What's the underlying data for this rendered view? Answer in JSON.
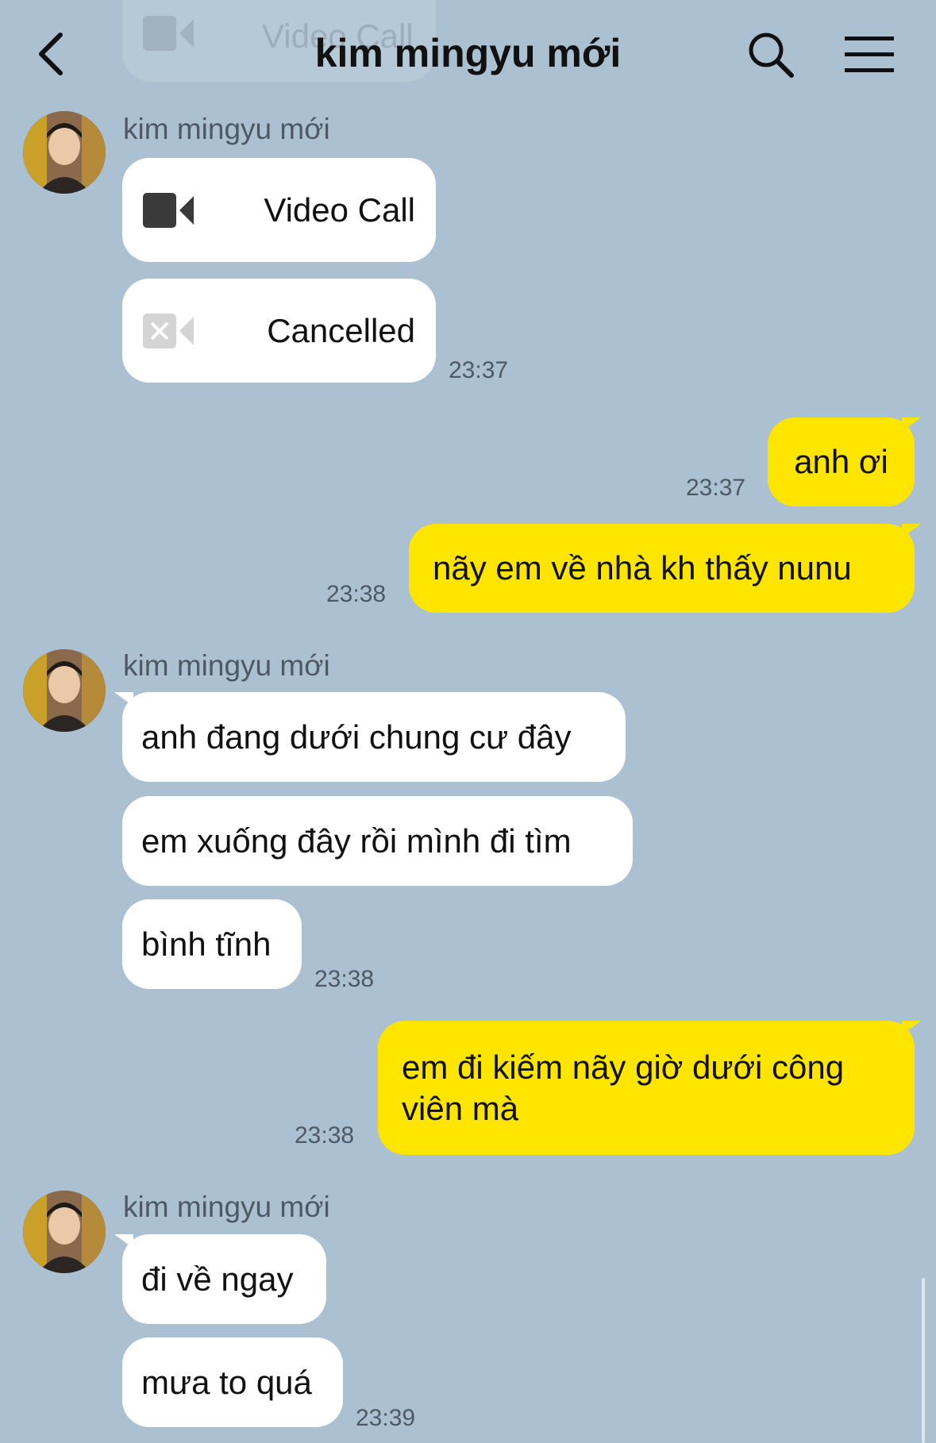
{
  "header": {
    "title": "kim mingyu mới",
    "back_icon": "chevron-left-icon",
    "search_icon": "search-icon",
    "menu_icon": "menu-icon"
  },
  "ghost_message": {
    "label": "Video Call"
  },
  "colors": {
    "background": "#abc1d1",
    "outgoing_bubble": "#fee500",
    "incoming_bubble": "#ffffff"
  },
  "messages": {
    "g1": {
      "sender": "kim mingyu mới",
      "call1": {
        "label": "Video Call",
        "icon": "video-camera-icon"
      },
      "call2": {
        "label": "Cancelled",
        "icon": "video-camera-cancelled-icon"
      },
      "time": "23:37"
    },
    "o1": {
      "text": "anh ơi",
      "time": "23:37"
    },
    "o2": {
      "text": "nãy em về nhà kh thấy nunu",
      "time": "23:38"
    },
    "g2": {
      "sender": "kim mingyu mới",
      "m1": "anh đang dưới chung cư đây",
      "m2": "em xuống đây rồi mình đi tìm",
      "m3": "bình tĩnh",
      "time": "23:38"
    },
    "o3": {
      "line1": "em đi kiếm nãy giờ dưới công",
      "line2": "viên mà",
      "time": "23:38"
    },
    "g3": {
      "sender": "kim mingyu mới",
      "m1": "đi về ngay",
      "m2": "mưa to quá",
      "time": "23:39"
    }
  }
}
